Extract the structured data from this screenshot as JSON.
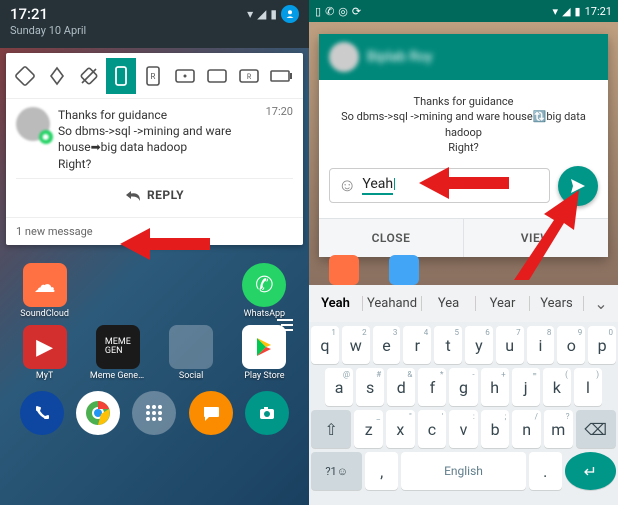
{
  "left": {
    "status": {
      "time": "17:21",
      "date": "Sunday 10 April"
    },
    "notif": {
      "time": "17:20",
      "line1": "Thanks for guidance",
      "line2": "So dbms->sql ->mining and ware house➡big data hadoop",
      "line3": "Right?",
      "reply_label": "REPLY",
      "footer": "1 new message"
    },
    "apps": {
      "soundcloud": "SoundCloud",
      "whatsapp": "WhatsApp",
      "myt": "MyT",
      "meme": "Meme Generat",
      "social": "Social",
      "playstore": "Play Store"
    }
  },
  "right": {
    "status": {
      "time": "17:21"
    },
    "dialog": {
      "contact": "Biplab Roy",
      "line1": "Thanks for guidance",
      "line2": "So dbms->sql ->mining and ware house🔃big data hadoop",
      "line3": "Right?",
      "input_value": "Yeah",
      "close": "CLOSE",
      "view": "VIEW"
    },
    "suggestions": [
      "Yeah",
      "Yeahand",
      "Yea",
      "Year",
      "Years"
    ],
    "keyboard": {
      "row1": [
        [
          "q",
          "1"
        ],
        [
          "w",
          "2"
        ],
        [
          "e",
          "3"
        ],
        [
          "r",
          "4"
        ],
        [
          "t",
          "5"
        ],
        [
          "y",
          "6"
        ],
        [
          "u",
          "7"
        ],
        [
          "i",
          "8"
        ],
        [
          "o",
          "9"
        ],
        [
          "p",
          "0"
        ]
      ],
      "row2": [
        [
          "a",
          "@"
        ],
        [
          "s",
          "#"
        ],
        [
          "d",
          "&"
        ],
        [
          "f",
          "*"
        ],
        [
          "g",
          "-"
        ],
        [
          "h",
          "+"
        ],
        [
          "j",
          "="
        ],
        [
          "k",
          "("
        ],
        [
          "l",
          ")"
        ]
      ],
      "row3": [
        [
          "z",
          "_"
        ],
        [
          "x",
          "\""
        ],
        [
          "c",
          "'"
        ],
        [
          "v",
          ":"
        ],
        [
          "b",
          ";"
        ],
        [
          "n",
          "/"
        ],
        [
          "m",
          "?"
        ]
      ],
      "symkey": "?1☺",
      "comma": ",",
      "space": "English",
      "period": "."
    }
  }
}
